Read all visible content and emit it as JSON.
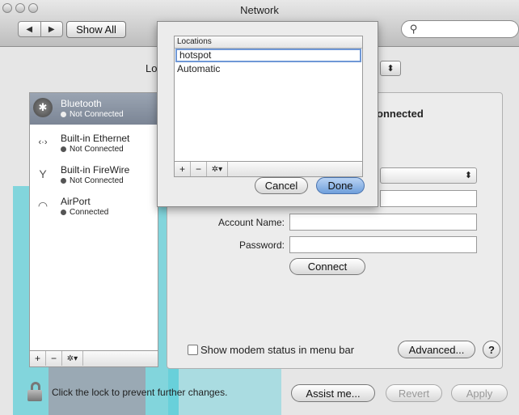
{
  "window": {
    "title": "Network"
  },
  "toolbar": {
    "back_glyph": "◀",
    "forward_glyph": "▶",
    "show_all": "Show All",
    "search_glyph": "⚲",
    "search_value": ""
  },
  "location": {
    "label_fragment": "Lo",
    "popup_glyph": "⬍"
  },
  "services": [
    {
      "name": "Bluetooth",
      "status": "Not Connected",
      "icon": "bluetooth-icon",
      "selected": true
    },
    {
      "name": "Built-in Ethernet",
      "status": "Not Connected",
      "icon": "ethernet-icon",
      "selected": false
    },
    {
      "name": "Built-in FireWire",
      "status": "Not Connected",
      "icon": "firewire-icon",
      "selected": false
    },
    {
      "name": "AirPort",
      "status": "Connected",
      "icon": "airport-icon",
      "selected": false
    }
  ],
  "list_bar": {
    "add": "+",
    "remove": "−",
    "gear": "✲▾"
  },
  "panel": {
    "status_fragment": "onnected",
    "popup_glyph": "⬍",
    "account_label": "Account Name:",
    "account_value": "",
    "password_label": "Password:",
    "password_value": "",
    "connect": "Connect",
    "show_modem": "Show modem status in menu bar",
    "advanced": "Advanced...",
    "help": "?"
  },
  "sheet": {
    "header": "Locations",
    "items": [
      "hotspot",
      "Automatic"
    ],
    "add": "+",
    "remove": "−",
    "gear": "✲▾",
    "cancel": "Cancel",
    "done": "Done"
  },
  "footer": {
    "lock_text": "Click the lock to prevent further changes.",
    "assist": "Assist me...",
    "revert": "Revert",
    "apply": "Apply"
  }
}
